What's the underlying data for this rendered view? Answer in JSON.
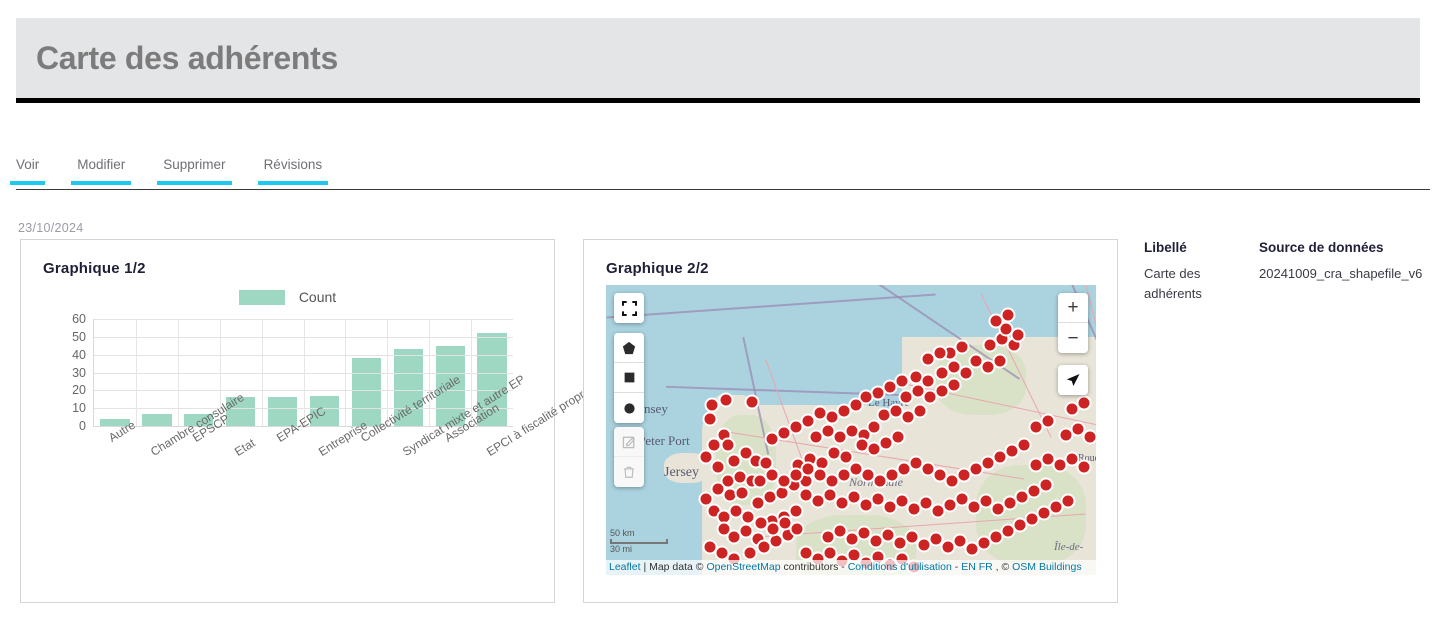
{
  "header": {
    "title": "Carte des adhérents"
  },
  "tabs": [
    {
      "label": "Voir"
    },
    {
      "label": "Modifier"
    },
    {
      "label": "Supprimer"
    },
    {
      "label": "Révisions"
    }
  ],
  "date": "23/10/2024",
  "panels": {
    "chart": {
      "title": "Graphique 1/2"
    },
    "map": {
      "title": "Graphique 2/2"
    }
  },
  "chart_data": {
    "type": "bar",
    "title": "Graphique 1/2",
    "xlabel": "",
    "ylabel": "",
    "ylim": [
      0,
      60
    ],
    "yticks": [
      0,
      10,
      20,
      30,
      40,
      50,
      60
    ],
    "grid": true,
    "legend_position": "top-center",
    "series": [
      {
        "name": "Count",
        "color": "#9ed8c3",
        "values": [
          4,
          7,
          7,
          16,
          16,
          17,
          38,
          43,
          45,
          52
        ]
      }
    ],
    "categories": [
      "Autre",
      "Chambre consulaire",
      "EPSCP",
      "Etat",
      "EPA-EPIC",
      "Entreprise",
      "Collectivité territoriale",
      "Syndicat mixte et autre EP",
      "Association",
      "EPCI à fiscalité propre"
    ]
  },
  "map": {
    "controls": {
      "fullscreen": "fullscreen-icon",
      "draw_polygon": "polygon-icon",
      "draw_rectangle": "rectangle-icon",
      "draw_circle": "circle-icon",
      "edit": "edit-icon",
      "delete": "trash-icon",
      "zoom_in": "+",
      "zoom_out": "−",
      "locate": "locate-arrow-icon"
    },
    "labels": [
      {
        "text": "Guernsey"
      },
      {
        "text": "St Peter Port"
      },
      {
        "text": "Jersey"
      },
      {
        "text": "Le Havre"
      },
      {
        "text": "Normandie"
      },
      {
        "text": "Île-de-"
      },
      {
        "text": "Rouen"
      }
    ],
    "scale": {
      "metric": "50 km",
      "imperial": "30 mi"
    },
    "attribution": {
      "leaflet": "Leaflet",
      "separator": " | ",
      "map_data": "Map data © ",
      "osm": "OpenStreetMap",
      "contributors": " contributors - ",
      "terms": "Conditions d'utilisation",
      "dash": " - ",
      "lang_en": "EN",
      "lang_fr": "FR",
      "comma": " , © ",
      "osm_buildings": "OSM Buildings"
    },
    "marker_color": "#ce2323"
  },
  "info": {
    "columns": [
      {
        "heading": "Libellé",
        "value": "Carte des adhérents"
      },
      {
        "heading": "Source de données",
        "value": "20241009_cra_shapefile_v6"
      }
    ]
  }
}
